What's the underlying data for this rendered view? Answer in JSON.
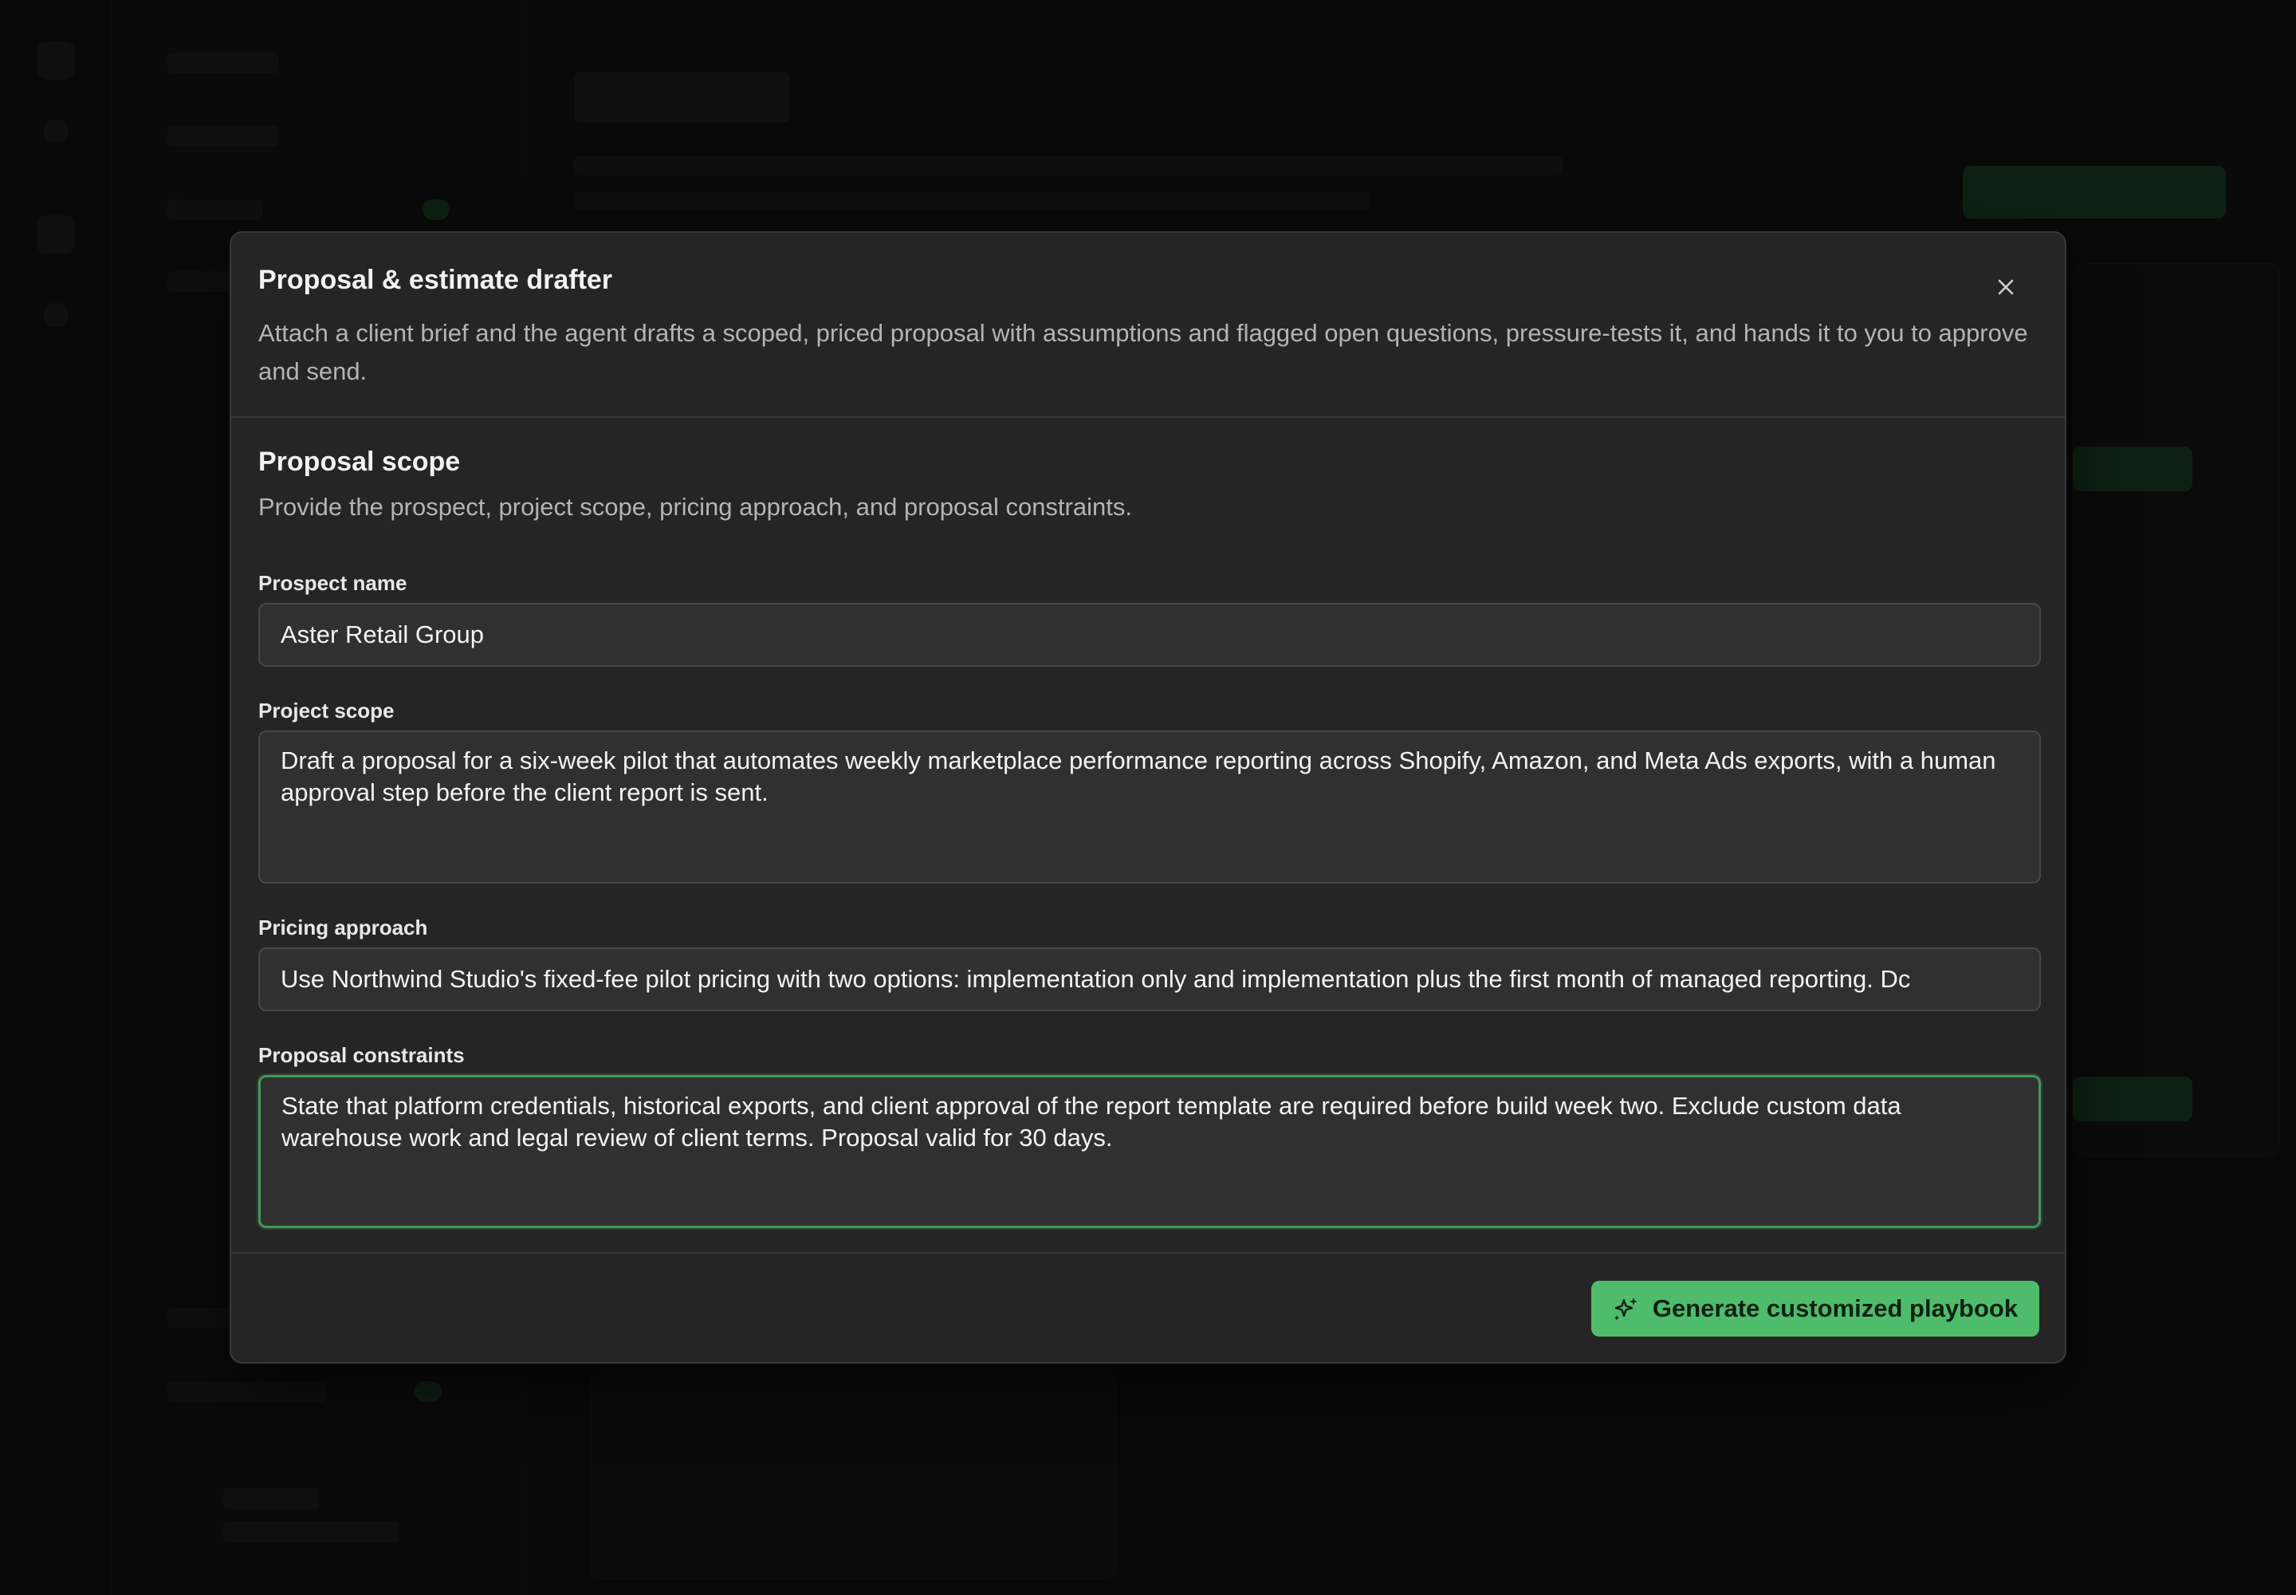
{
  "modal": {
    "title": "Proposal & estimate drafter",
    "description": "Attach a client brief and the agent drafts a scoped, priced proposal with assumptions and flagged open questions, pressure-tests it, and hands it to you to approve and send.",
    "close_icon": "close-icon"
  },
  "section": {
    "title": "Proposal scope",
    "description": "Provide the prospect, project scope, pricing approach, and proposal constraints."
  },
  "fields": {
    "prospect_name": {
      "label": "Prospect name",
      "value": "Aster Retail Group"
    },
    "project_scope": {
      "label": "Project scope",
      "value": "Draft a proposal for a six-week pilot that automates weekly marketplace performance reporting across Shopify, Amazon, and Meta Ads exports, with a human approval step before the client report is sent."
    },
    "pricing_approach": {
      "label": "Pricing approach",
      "value": "Use Northwind Studio's fixed-fee pilot pricing with two options: implementation only and implementation plus the first month of managed reporting. Dc"
    },
    "proposal_constraints": {
      "label": "Proposal constraints",
      "value": "State that platform credentials, historical exports, and client approval of the report template are required before build week two. Exclude custom data warehouse work and legal review of client terms. Proposal valid for 30 days."
    }
  },
  "footer": {
    "generate_label": "Generate customized playbook",
    "generate_icon": "sparkles-icon"
  },
  "colors": {
    "accent": "#4dbd6b",
    "focus_border": "#3e9a57",
    "modal_bg": "#252525",
    "field_bg": "#303030"
  }
}
